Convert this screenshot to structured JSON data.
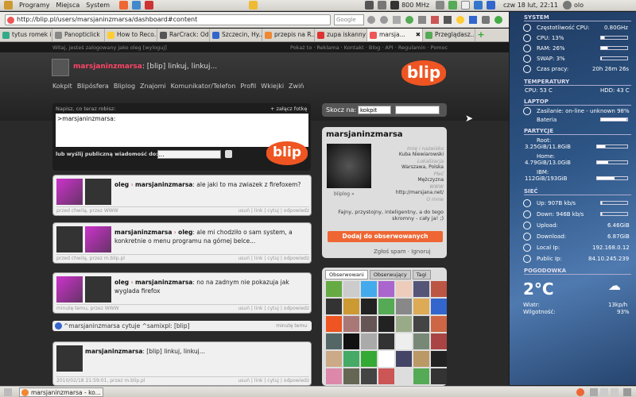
{
  "topbar": {
    "menus": [
      "Programy",
      "Miejsca",
      "System"
    ],
    "cpu": "800 MHz",
    "clock": "czw 18 lut, 22:11",
    "user": "olo"
  },
  "browser": {
    "url": "http://blip.pl/users/marsjaninzmarsa/dashboard#content",
    "search_placeholder": "Google"
  },
  "tabs": [
    {
      "label": "tytus romek i...",
      "color": "#3a8"
    },
    {
      "label": "Panopticlick",
      "color": "#888"
    },
    {
      "label": "How to Reco...",
      "color": "#fc3"
    },
    {
      "label": "RarCrack: Od...",
      "color": "#555"
    },
    {
      "label": "Szczecin, Hy...",
      "color": "#36c"
    },
    {
      "label": "przepis na R...",
      "color": "#e83"
    },
    {
      "label": "zupa iskanny",
      "color": "#d33"
    },
    {
      "label": "marsja...",
      "color": "#e55"
    },
    {
      "label": "Przeglądasz...",
      "color": "#5a5"
    }
  ],
  "page": {
    "greeting": "Witaj, jesteś zalogowany jako oleg [wyloguj]",
    "toplinks": "Pokaż to · Reklama · Kontakt · Blog · API · Regulamin · Pomoc",
    "header_user": "marsjaninzmarsa",
    "header_status": ": [blip] linkuj, linkuj...",
    "logo": "blip",
    "nav": [
      "Kokpit",
      "Blipósfera",
      "Bliplog",
      "Znajomi",
      "Komunikator/Telefon",
      "Profil",
      "Wkiejki",
      "Zwiń"
    ],
    "compose": {
      "label": "Napisz, co teraz robisz:",
      "attach": "+ załącz fotkę",
      "text": ">marsjaninzmarsa:",
      "send_label": "lub wyślij publiczną wiadomość do:",
      "select": "..."
    },
    "posts": [
      {
        "author": "oleg",
        "target": "marsjaninzmarsa",
        "text": ": ale jaki to ma zwiazek z firefoxem?",
        "meta": "przed chwilą, przez WWW",
        "actions": "usuń | link | cytuj | odpowiedz"
      },
      {
        "author": "marsjaninzmarsa",
        "target": "oleg",
        "text": ": ale mi chodziło o sam system, a konkretnie o menu programu na górnej belce...",
        "meta": "przed chwilą, przez m.blip.pl",
        "actions": "usuń | link | cytuj | odpowiedz"
      },
      {
        "author": "oleg",
        "target": "marsjaninzmarsa",
        "text": ": no na zadnym nie pokazuja jak wyglada firefox",
        "meta": "minutę temu, przez WWW",
        "actions": "usuń | link | cytuj | odpowiedz"
      },
      {
        "author": "marsjaninzmarsa",
        "target": "",
        "text": ": [blip] linkuj, linkuj...",
        "meta": "2010/02/18 21:59:01, przez m.blip.pl",
        "actions": "usuń | link | cytuj | odpowiedz"
      }
    ],
    "quote": {
      "text": "^marsjaninzmarsa cytuje ^samixpl: [blip]",
      "time": "minutę temu"
    },
    "jump": {
      "label": "Skocz na:",
      "select": "kokpit"
    },
    "profile": {
      "name": "marsjaninzmarsa",
      "avatar_label": "bliplog »",
      "fields": [
        {
          "label": "Imię i nazwisko",
          "value": "Kuba Niewiarowski"
        },
        {
          "label": "Lokalizacja",
          "value": "Warszawa, Polska"
        },
        {
          "label": "Płeć",
          "value": "Mężczyzna"
        },
        {
          "label": "WWW",
          "value": "http://marsjana.net/"
        },
        {
          "label": "O mnie",
          "value": ""
        }
      ],
      "about": "Fajny, przystojny, inteligentny, a do tego skromny - cały ja! ;)",
      "follow": "Dodaj do obserwowanych",
      "spam": "Zgłoś spam · Ignoruj"
    },
    "grid_tabs": [
      "Obserwowani",
      "Obserwujący",
      "Tagi"
    ]
  },
  "sidebar": {
    "system_title": "SYSTEM",
    "cpu_freq_label": "Częstotliwość CPU:",
    "cpu_freq": "0.80GHz",
    "cpu_label": "CPU: 13%",
    "cpu_pct": 13,
    "ram_label": "RAM: 26%",
    "ram_pct": 26,
    "swap_label": "SWAP: 3%",
    "swap_pct": 3,
    "uptime_label": "Czas pracy:",
    "uptime": "20h 26m 26s",
    "temp_title": "TEMPERATURY",
    "cpu_temp": "CPU: 53 C",
    "hdd_temp": "HDD: 43 C",
    "laptop_title": "LAPTOP",
    "power": "Zasilanie: on-line - unknown 98%",
    "battery_label": "Bateria",
    "battery_pct": 98,
    "part_title": "PARTYCJE",
    "parts": [
      {
        "name": "Root:",
        "size": "3.25GiB/11.8GiB",
        "pct": 28
      },
      {
        "name": "Home:",
        "size": "4.79GiB/13.0GiB",
        "pct": 37
      },
      {
        "name": "IBM:",
        "size": "112GiB/193GiB",
        "pct": 58
      }
    ],
    "net_title": "SIEĆ",
    "up": "Up: 907B  kb/s",
    "down": "Down: 946B  kb/s",
    "upload_label": "Upload:",
    "upload": "6.46GiB",
    "download_label": "Download:",
    "download": "6.87GiB",
    "localip_label": "Local Ip:",
    "localip": "192.168.0.12",
    "publicip_label": "Public Ip:",
    "publicip": "84.10.245.239",
    "weather_title": "POGODOWKA",
    "temp": "2°C",
    "wind_label": "Wiatr:",
    "wind": "13kp/h",
    "humidity_label": "Wilgotność:",
    "humidity": "93%"
  },
  "taskbar": {
    "window": "marsjaninzmarsa - ko..."
  }
}
